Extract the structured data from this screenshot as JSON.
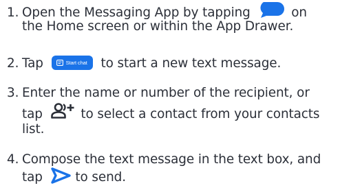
{
  "colors": {
    "text": "#2b2f38",
    "accent_blue": "#1a73e8"
  },
  "icons": {
    "messages_app": "messages-bubble-icon",
    "start_chat": "chat-icon",
    "add_contact": "add-contact-icon",
    "send": "send-arrow-icon"
  },
  "steps": [
    {
      "number": "1.",
      "line1_before": "Open the Messaging App by tapping",
      "line1_after": "on",
      "line2": "the Home screen or within the App Drawer."
    },
    {
      "number": "2.",
      "before": "Tap",
      "button_label": "Start chat",
      "after": "to start a new text message."
    },
    {
      "number": "3.",
      "line1": "Enter the name or number of the recipient, or",
      "line2_before": "tap",
      "line2_after": "to select a contact from your contacts",
      "line3": "list."
    },
    {
      "number": "4.",
      "line1": "Compose the text message in the text box, and",
      "line2_before": "tap",
      "line2_after": "to send."
    }
  ]
}
